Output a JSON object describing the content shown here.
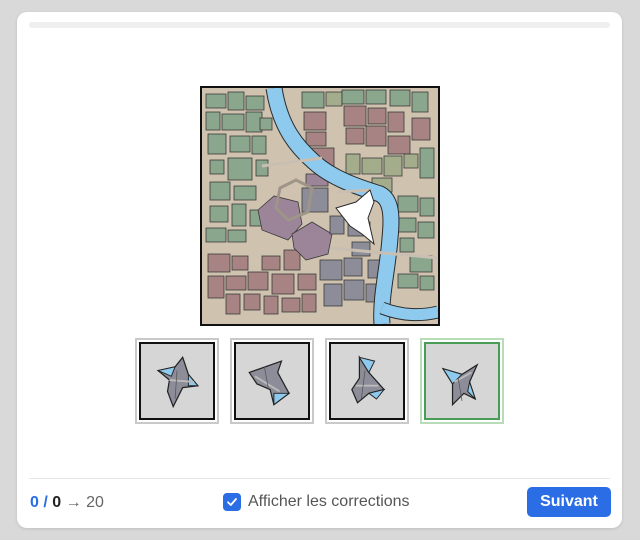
{
  "progress": {
    "fraction": 0
  },
  "map": {
    "name": "",
    "target_piece_color": "#ffffff"
  },
  "choices": [
    {
      "id": "choice-1",
      "selected": false
    },
    {
      "id": "choice-2",
      "selected": false
    },
    {
      "id": "choice-3",
      "selected": false
    },
    {
      "id": "choice-4",
      "selected": true
    }
  ],
  "footer": {
    "score_correct": "0",
    "score_separator": "/",
    "score_total": "0",
    "arrow": "→",
    "goal": "20",
    "show_corrections_label": "Afficher les corrections",
    "show_corrections_checked": true,
    "next_label": "Suivant"
  },
  "colors": {
    "accent": "#2b6de5",
    "selected_border": "#4a9d57",
    "river": "#8ec9ee",
    "green_buildings": "#8aa68c",
    "red_buildings": "#a78383",
    "purple_buildings": "#9c8598",
    "gray_buildings": "#8c8d98",
    "olive_buildings": "#a3ad8c",
    "ground": "#cfc3b0"
  }
}
